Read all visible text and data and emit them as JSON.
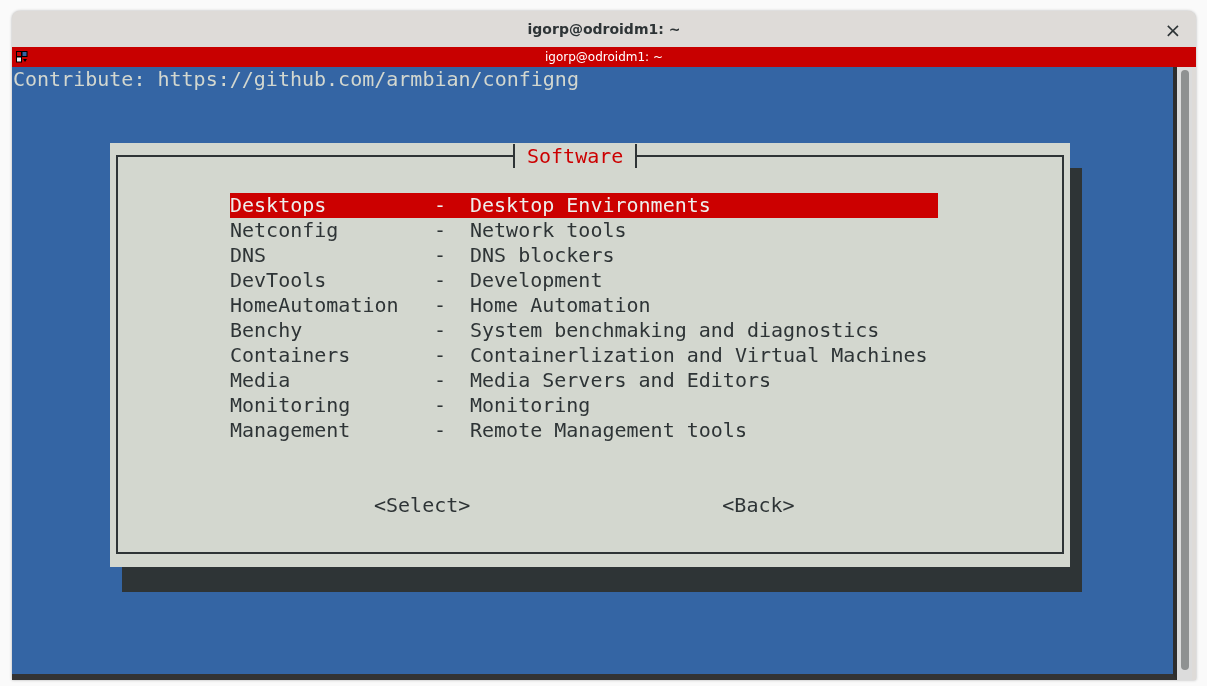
{
  "window": {
    "title": "igorp@odroidm1: ~",
    "close": "×"
  },
  "terminal": {
    "title": "igorp@odroidm1: ~",
    "lines": [
      "Contribute: https://github.com/armbian/configng"
    ]
  },
  "dialog": {
    "title": "Software",
    "items": [
      {
        "tag": "Desktops",
        "separator": "-",
        "description": "Desktop Environments",
        "selected": true
      },
      {
        "tag": "Netconfig",
        "separator": "-",
        "description": "Network tools",
        "selected": false
      },
      {
        "tag": "DNS",
        "separator": "-",
        "description": "DNS blockers",
        "selected": false
      },
      {
        "tag": "DevTools",
        "separator": "-",
        "description": "Development",
        "selected": false
      },
      {
        "tag": "HomeAutomation",
        "separator": "-",
        "description": "Home Automation",
        "selected": false
      },
      {
        "tag": "Benchy",
        "separator": "-",
        "description": "System benchmaking and diagnostics",
        "selected": false
      },
      {
        "tag": "Containers",
        "separator": "-",
        "description": "Containerlization and Virtual Machines",
        "selected": false
      },
      {
        "tag": "Media",
        "separator": "-",
        "description": "Media Servers and Editors",
        "selected": false
      },
      {
        "tag": "Monitoring",
        "separator": "-",
        "description": "Monitoring",
        "selected": false
      },
      {
        "tag": "Management",
        "separator": "-",
        "description": "Remote Management tools",
        "selected": false
      }
    ],
    "buttons": [
      "<Select>",
      "<Back>"
    ]
  }
}
